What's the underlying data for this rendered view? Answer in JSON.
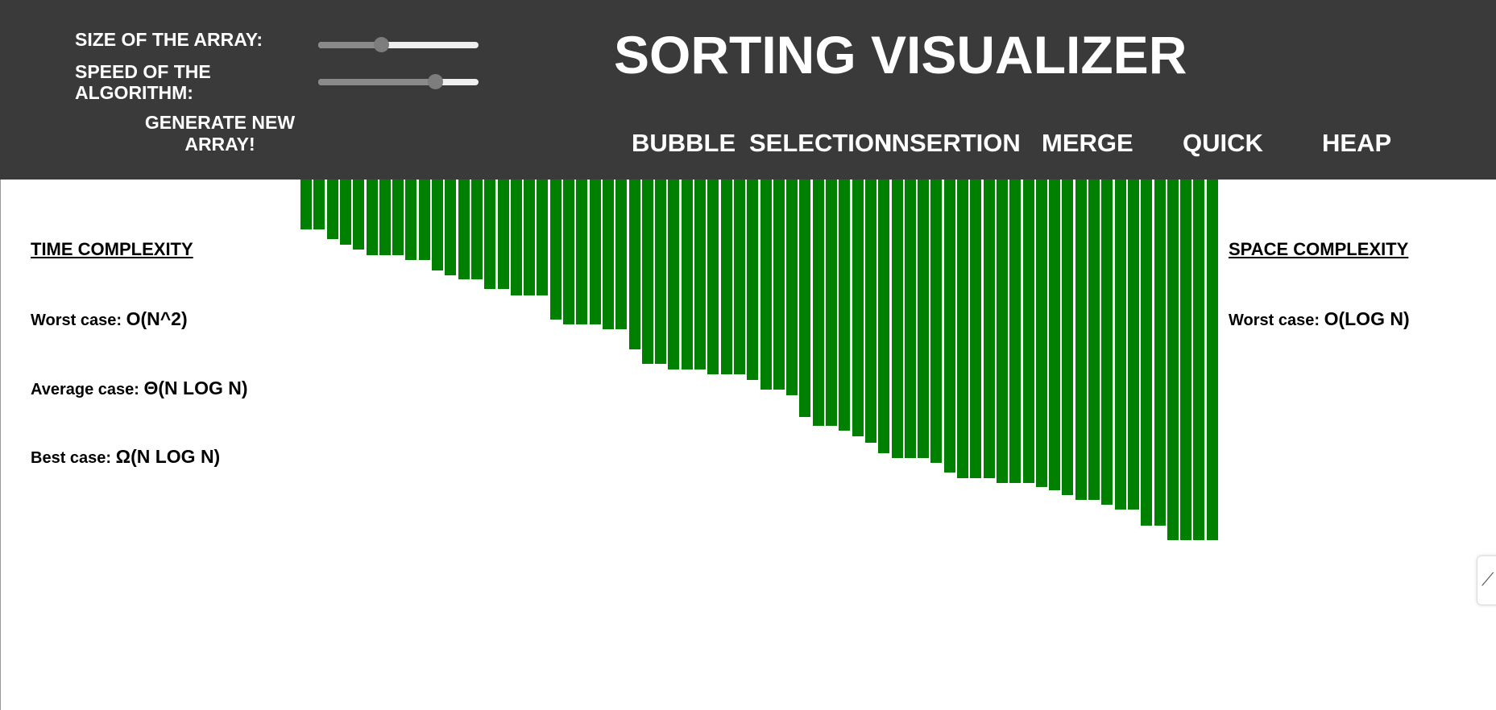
{
  "controls": {
    "size_label": "SIZE OF THE ARRAY:",
    "size_value": 0.39,
    "speed_label_line1": "SPEED OF THE",
    "speed_label_line2": "ALGORITHM:",
    "speed_value": 0.73,
    "generate_line1": "GENERATE NEW",
    "generate_line2": "ARRAY!"
  },
  "title": "SORTING VISUALIZER",
  "algorithms": [
    "BUBBLE",
    "SELECTION",
    "INSERTION",
    "MERGE",
    "QUICK",
    "HEAP"
  ],
  "time_complexity": {
    "heading": "TIME COMPLEXITY",
    "worst_label": "Worst case:",
    "worst_value": "O(N^2)",
    "average_label": "Average case:",
    "average_value": "Θ(N LOG N)",
    "best_label": "Best case:",
    "best_value": "Ω(N LOG N)"
  },
  "space_complexity": {
    "heading": "SPACE COMPLEXITY",
    "worst_label": "Worst case:",
    "worst_value": "O(LOG N)"
  },
  "bar_color": "#008000",
  "header_color": "#3a3a3a",
  "chart_data": {
    "type": "bar",
    "values": [
      62,
      62,
      74,
      81,
      87,
      94,
      94,
      94,
      100,
      100,
      113,
      119,
      124,
      124,
      136,
      136,
      144,
      144,
      144,
      174,
      180,
      180,
      180,
      186,
      186,
      211,
      229,
      229,
      236,
      236,
      236,
      242,
      242,
      242,
      249,
      261,
      261,
      268,
      295,
      306,
      306,
      312,
      319,
      327,
      340,
      346,
      346,
      346,
      352,
      364,
      371,
      371,
      371,
      377,
      377,
      377,
      382,
      386,
      392,
      398,
      398,
      404,
      410,
      410,
      430,
      430,
      448,
      448,
      448,
      448
    ]
  }
}
